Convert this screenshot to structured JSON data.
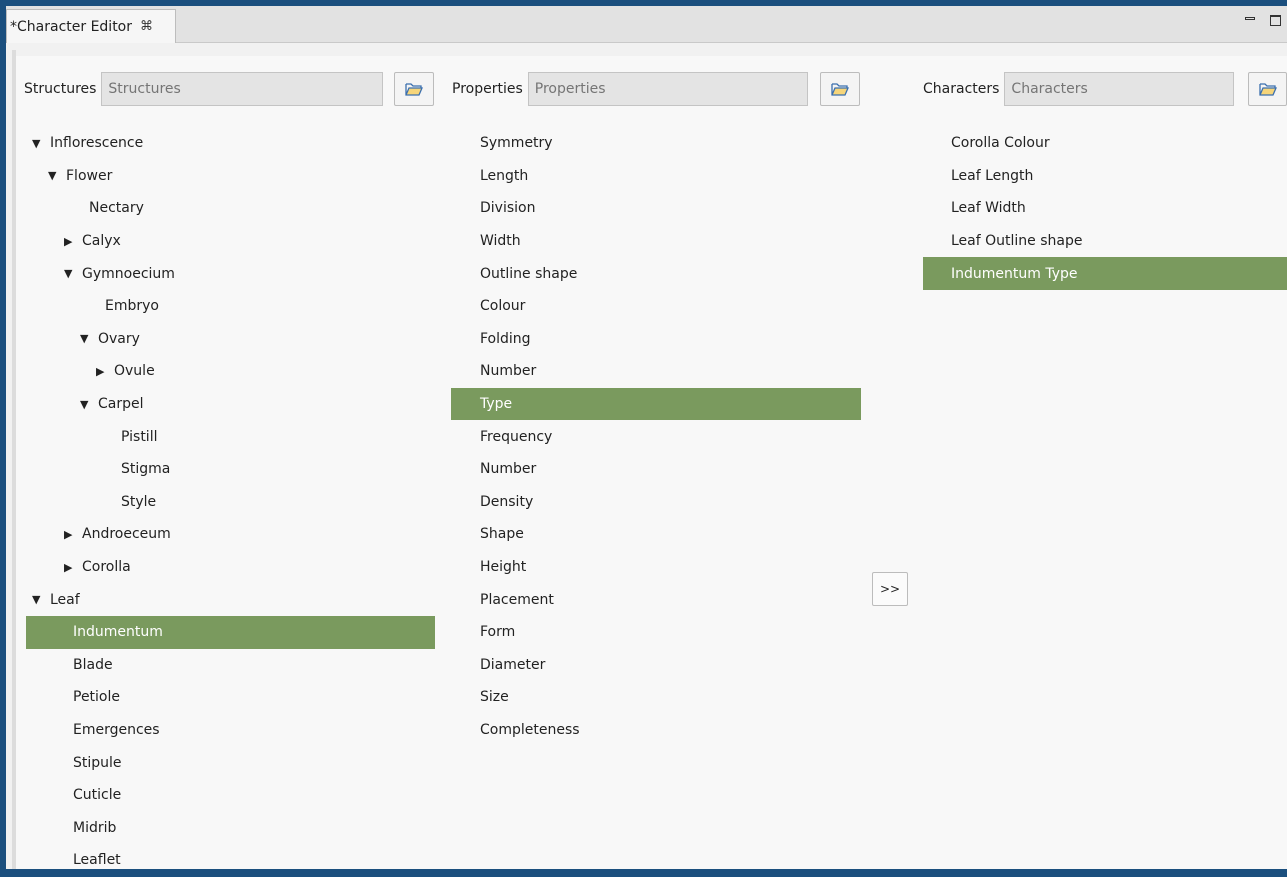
{
  "tab": {
    "title": "*Character Editor",
    "close_glyph": "⌘"
  },
  "structures": {
    "label": "Structures",
    "placeholder": "Structures",
    "tree": [
      {
        "label": "Inflorescence",
        "depth": 0,
        "expander": "expanded"
      },
      {
        "label": "Flower",
        "depth": 1,
        "expander": "expanded"
      },
      {
        "label": "Nectary",
        "depth": 2,
        "expander": "none"
      },
      {
        "label": "Calyx",
        "depth": 2,
        "expander": "collapsed"
      },
      {
        "label": "Gymnoecium",
        "depth": 2,
        "expander": "expanded"
      },
      {
        "label": "Embryo",
        "depth": 3,
        "expander": "none"
      },
      {
        "label": "Ovary",
        "depth": 3,
        "expander": "expanded"
      },
      {
        "label": "Ovule",
        "depth": 4,
        "expander": "collapsed"
      },
      {
        "label": "Carpel",
        "depth": 3,
        "expander": "expanded"
      },
      {
        "label": "Pistill",
        "depth": 4,
        "expander": "none"
      },
      {
        "label": "Stigma",
        "depth": 4,
        "expander": "none"
      },
      {
        "label": "Style",
        "depth": 4,
        "expander": "none"
      },
      {
        "label": "Androeceum",
        "depth": 2,
        "expander": "collapsed"
      },
      {
        "label": "Corolla",
        "depth": 2,
        "expander": "collapsed"
      },
      {
        "label": "Leaf",
        "depth": 0,
        "expander": "expanded"
      },
      {
        "label": "Indumentum",
        "depth": 1,
        "expander": "none",
        "selected": true
      },
      {
        "label": "Blade",
        "depth": 1,
        "expander": "none"
      },
      {
        "label": "Petiole",
        "depth": 1,
        "expander": "none"
      },
      {
        "label": "Emergences",
        "depth": 1,
        "expander": "none"
      },
      {
        "label": "Stipule",
        "depth": 1,
        "expander": "none"
      },
      {
        "label": "Cuticle",
        "depth": 1,
        "expander": "none"
      },
      {
        "label": "Midrib",
        "depth": 1,
        "expander": "none"
      },
      {
        "label": "Leaflet",
        "depth": 1,
        "expander": "none"
      }
    ]
  },
  "properties": {
    "label": "Properties",
    "placeholder": "Properties",
    "items": [
      {
        "label": "Symmetry"
      },
      {
        "label": "Length"
      },
      {
        "label": "Division"
      },
      {
        "label": "Width"
      },
      {
        "label": "Outline shape"
      },
      {
        "label": "Colour"
      },
      {
        "label": "Folding"
      },
      {
        "label": "Number"
      },
      {
        "label": "Type",
        "selected": true
      },
      {
        "label": "Frequency"
      },
      {
        "label": "Number"
      },
      {
        "label": "Density"
      },
      {
        "label": "Shape"
      },
      {
        "label": "Height"
      },
      {
        "label": "Placement"
      },
      {
        "label": "Form"
      },
      {
        "label": "Diameter"
      },
      {
        "label": "Size"
      },
      {
        "label": "Completeness"
      }
    ]
  },
  "characters": {
    "label": "Characters",
    "placeholder": "Characters",
    "items": [
      {
        "label": "Corolla Colour"
      },
      {
        "label": "Leaf Length"
      },
      {
        "label": "Leaf Width"
      },
      {
        "label": "Leaf Outline shape"
      },
      {
        "label": "Indumentum Type",
        "selected": true
      }
    ]
  },
  "move_button": {
    "label": ">>"
  },
  "colors": {
    "selection": "#7a9a5e",
    "accent_border": "#1b4f7e"
  },
  "icons": {
    "folder": "open-folder-icon",
    "minimize": "minimize-icon",
    "maximize": "maximize-icon",
    "close": "close-tab-icon"
  }
}
